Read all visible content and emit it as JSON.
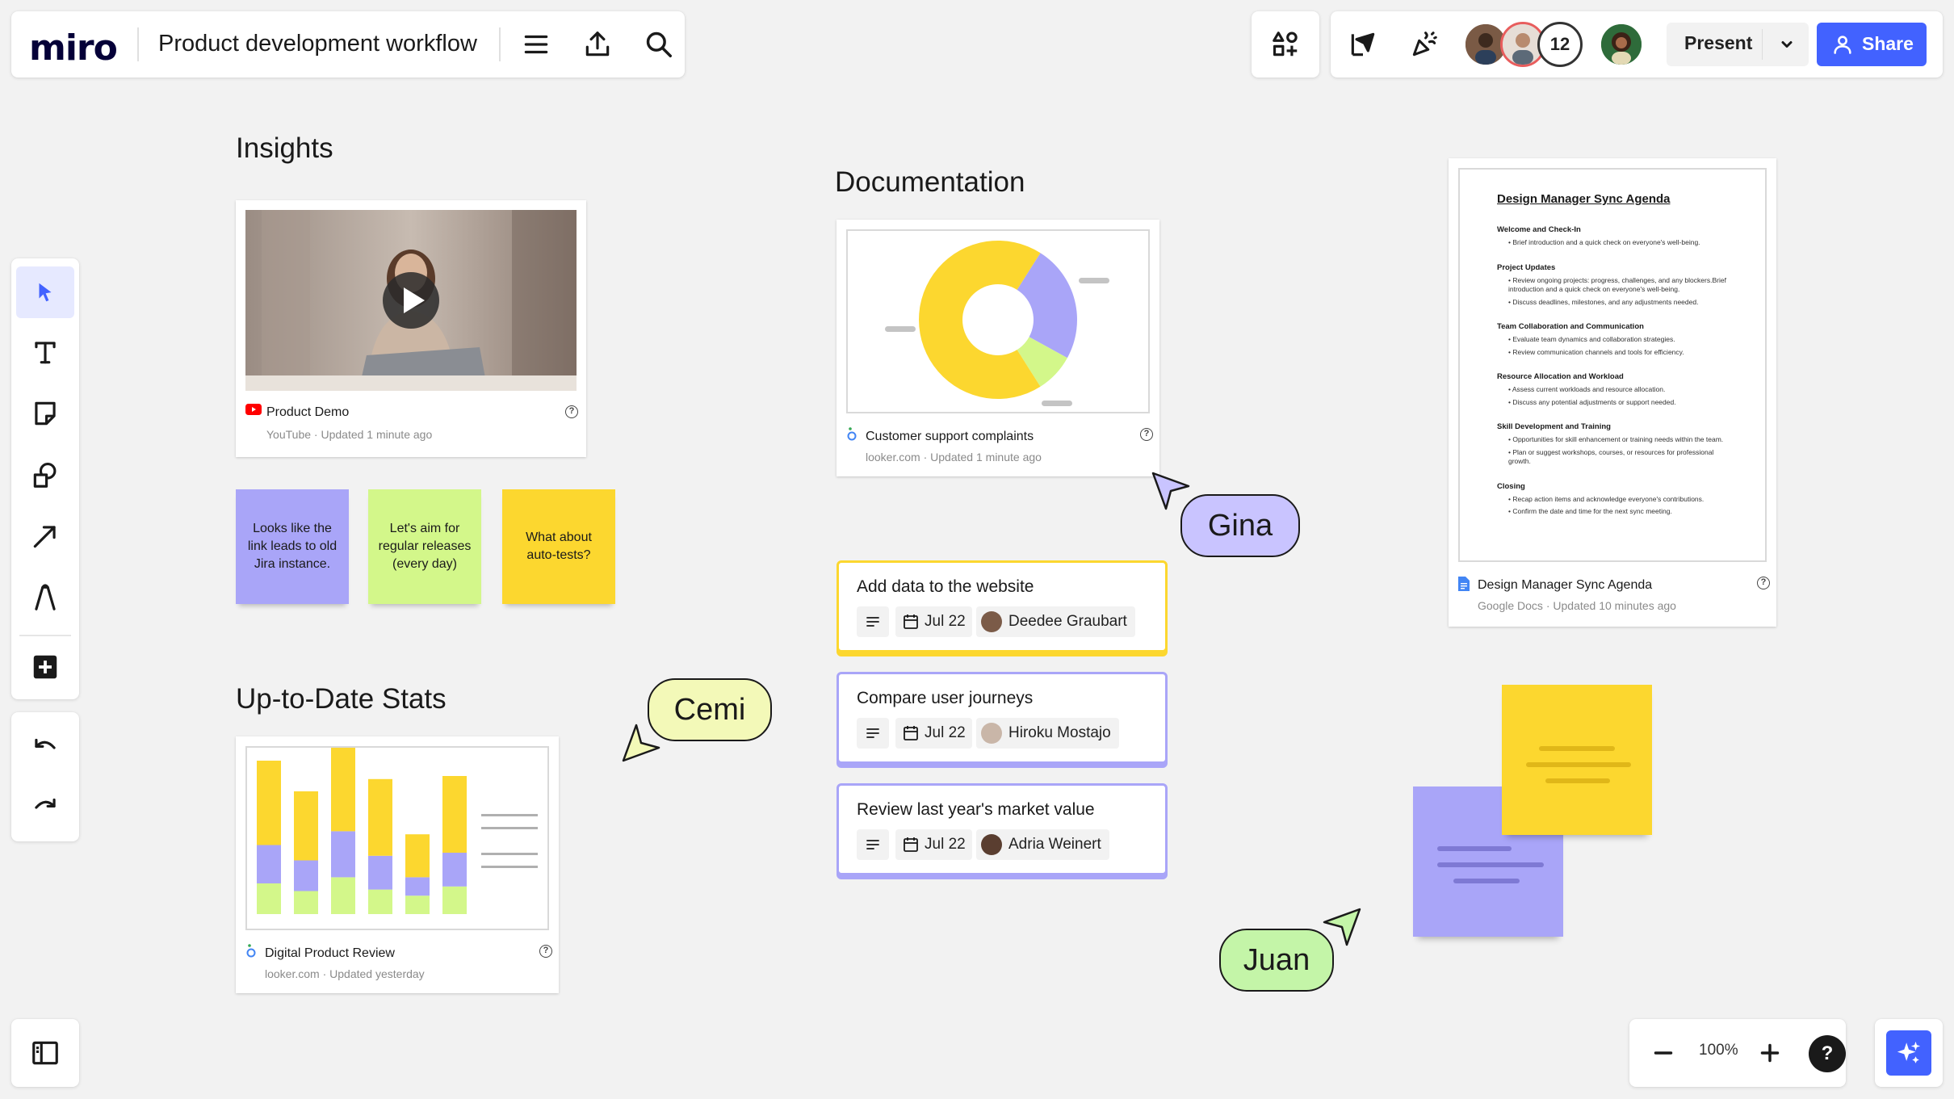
{
  "app": {
    "logo": "miro",
    "board_title": "Product development workflow"
  },
  "topbar": {
    "collaborator_count": "12",
    "present_label": "Present",
    "share_label": "Share"
  },
  "sections": {
    "insights": "Insights",
    "documentation": "Documentation",
    "stats": "Up-to-Date Stats"
  },
  "cards": {
    "video": {
      "title": "Product Demo",
      "source": "YouTube",
      "updated": "Updated 1 minute ago",
      "help": "?"
    },
    "donut": {
      "title": "Customer support complaints",
      "source": "looker.com",
      "updated": "Updated 1 minute ago",
      "help": "?"
    },
    "bars": {
      "title": "Digital Product Review",
      "source": "looker.com",
      "updated": "Updated yesterday",
      "help": "?"
    },
    "doc": {
      "title": "Design Manager Sync Agenda",
      "source": "Google Docs",
      "updated": "Updated 10 minutes ago",
      "help": "?",
      "heading": "Design Manager Sync Agenda",
      "sections": [
        {
          "h": "Welcome and Check-In",
          "items": [
            "Brief introduction and a quick check on everyone's well-being."
          ]
        },
        {
          "h": "Project Updates",
          "items": [
            "Review ongoing projects: progress, challenges, and any blockers.Brief introduction and a quick check on everyone's well-being.",
            "Discuss deadlines, milestones, and any adjustments needed."
          ]
        },
        {
          "h": "Team Collaboration and Communication",
          "items": [
            "Evaluate team dynamics and collaboration strategies.",
            "Review communication channels and tools for efficiency."
          ]
        },
        {
          "h": "Resource Allocation and Workload",
          "items": [
            "Assess current workloads and resource allocation.",
            "Discuss any potential adjustments or support needed."
          ]
        },
        {
          "h": "Skill Development and Training",
          "items": [
            "Opportunities for skill enhancement or training needs within the team.",
            "Plan or suggest workshops, courses, or resources for professional growth."
          ]
        },
        {
          "h": "Closing",
          "items": [
            "Recap action items and acknowledge everyone's contributions.",
            "Confirm the date and time for the next sync meeting."
          ]
        }
      ]
    }
  },
  "stickies": [
    {
      "text": "Looks like the link leads to old Jira instance.",
      "color": "#a9a5f8"
    },
    {
      "text": "Let's aim for regular releases (every day)",
      "color": "#d3f78a"
    },
    {
      "text": "What about auto-tests?",
      "color": "#fcd72f"
    }
  ],
  "tasks": [
    {
      "title": "Add data to the website",
      "date": "Jul 22",
      "assignee": "Deedee Graubart",
      "border": "#fcd72f"
    },
    {
      "title": "Compare user journeys",
      "date": "Jul 22",
      "assignee": "Hiroku Mostajo",
      "border": "#a9a5f8"
    },
    {
      "title": "Review last year's market value",
      "date": "Jul 22",
      "assignee": "Adria Weinert",
      "border": "#a9a5f8"
    }
  ],
  "cursors": [
    {
      "name": "Gina",
      "color": "#c9c4ff"
    },
    {
      "name": "Cemi",
      "color": "#f3f9b8"
    },
    {
      "name": "Juan",
      "color": "#c4f5a8"
    }
  ],
  "zoom": {
    "level": "100%",
    "help": "?"
  },
  "colors": {
    "accent": "#4262ff",
    "yellow": "#fcd72f",
    "purple": "#a9a5f8",
    "green": "#d3f78a"
  },
  "chart_data": [
    {
      "type": "pie",
      "categories": [
        "yellow",
        "purple",
        "green"
      ],
      "values": [
        68,
        24,
        8
      ]
    },
    {
      "type": "bar",
      "categories": [
        "1",
        "2",
        "3",
        "4",
        "5",
        "6"
      ],
      "series": [
        {
          "values": [
            20,
            15,
            24,
            16,
            12,
            18
          ]
        },
        {
          "values": [
            25,
            20,
            30,
            22,
            12,
            22
          ]
        },
        {
          "values": [
            55,
            45,
            60,
            50,
            28,
            50
          ]
        }
      ]
    }
  ]
}
